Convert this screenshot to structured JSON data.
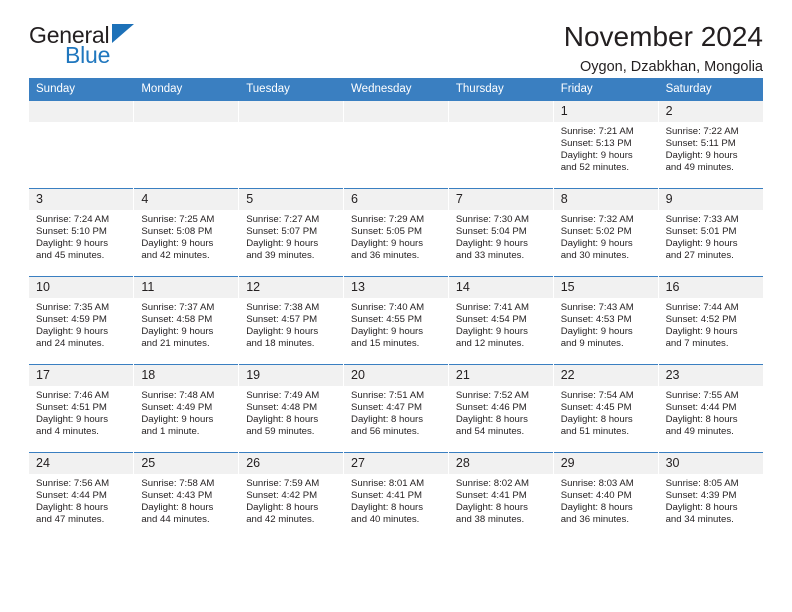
{
  "logo": {
    "line1": "General",
    "line2": "Blue",
    "triangle_icon": "triangle-icon",
    "color_dark": "#231f20",
    "color_blue": "#1d71b8"
  },
  "header": {
    "title": "November 2024",
    "subtitle": "Oygon, Dzabkhan, Mongolia"
  },
  "theme": {
    "header_blue": "#3a7fc1",
    "daynum_bg": "#f1f1f1",
    "text": "#231f20"
  },
  "weekday_headers": [
    "Sunday",
    "Monday",
    "Tuesday",
    "Wednesday",
    "Thursday",
    "Friday",
    "Saturday"
  ],
  "weeks": [
    [
      {
        "day": "",
        "sunrise": "",
        "sunset": "",
        "daylight1": "",
        "daylight2": ""
      },
      {
        "day": "",
        "sunrise": "",
        "sunset": "",
        "daylight1": "",
        "daylight2": ""
      },
      {
        "day": "",
        "sunrise": "",
        "sunset": "",
        "daylight1": "",
        "daylight2": ""
      },
      {
        "day": "",
        "sunrise": "",
        "sunset": "",
        "daylight1": "",
        "daylight2": ""
      },
      {
        "day": "",
        "sunrise": "",
        "sunset": "",
        "daylight1": "",
        "daylight2": ""
      },
      {
        "day": "1",
        "sunrise": "Sunrise: 7:21 AM",
        "sunset": "Sunset: 5:13 PM",
        "daylight1": "Daylight: 9 hours",
        "daylight2": "and 52 minutes."
      },
      {
        "day": "2",
        "sunrise": "Sunrise: 7:22 AM",
        "sunset": "Sunset: 5:11 PM",
        "daylight1": "Daylight: 9 hours",
        "daylight2": "and 49 minutes."
      }
    ],
    [
      {
        "day": "3",
        "sunrise": "Sunrise: 7:24 AM",
        "sunset": "Sunset: 5:10 PM",
        "daylight1": "Daylight: 9 hours",
        "daylight2": "and 45 minutes."
      },
      {
        "day": "4",
        "sunrise": "Sunrise: 7:25 AM",
        "sunset": "Sunset: 5:08 PM",
        "daylight1": "Daylight: 9 hours",
        "daylight2": "and 42 minutes."
      },
      {
        "day": "5",
        "sunrise": "Sunrise: 7:27 AM",
        "sunset": "Sunset: 5:07 PM",
        "daylight1": "Daylight: 9 hours",
        "daylight2": "and 39 minutes."
      },
      {
        "day": "6",
        "sunrise": "Sunrise: 7:29 AM",
        "sunset": "Sunset: 5:05 PM",
        "daylight1": "Daylight: 9 hours",
        "daylight2": "and 36 minutes."
      },
      {
        "day": "7",
        "sunrise": "Sunrise: 7:30 AM",
        "sunset": "Sunset: 5:04 PM",
        "daylight1": "Daylight: 9 hours",
        "daylight2": "and 33 minutes."
      },
      {
        "day": "8",
        "sunrise": "Sunrise: 7:32 AM",
        "sunset": "Sunset: 5:02 PM",
        "daylight1": "Daylight: 9 hours",
        "daylight2": "and 30 minutes."
      },
      {
        "day": "9",
        "sunrise": "Sunrise: 7:33 AM",
        "sunset": "Sunset: 5:01 PM",
        "daylight1": "Daylight: 9 hours",
        "daylight2": "and 27 minutes."
      }
    ],
    [
      {
        "day": "10",
        "sunrise": "Sunrise: 7:35 AM",
        "sunset": "Sunset: 4:59 PM",
        "daylight1": "Daylight: 9 hours",
        "daylight2": "and 24 minutes."
      },
      {
        "day": "11",
        "sunrise": "Sunrise: 7:37 AM",
        "sunset": "Sunset: 4:58 PM",
        "daylight1": "Daylight: 9 hours",
        "daylight2": "and 21 minutes."
      },
      {
        "day": "12",
        "sunrise": "Sunrise: 7:38 AM",
        "sunset": "Sunset: 4:57 PM",
        "daylight1": "Daylight: 9 hours",
        "daylight2": "and 18 minutes."
      },
      {
        "day": "13",
        "sunrise": "Sunrise: 7:40 AM",
        "sunset": "Sunset: 4:55 PM",
        "daylight1": "Daylight: 9 hours",
        "daylight2": "and 15 minutes."
      },
      {
        "day": "14",
        "sunrise": "Sunrise: 7:41 AM",
        "sunset": "Sunset: 4:54 PM",
        "daylight1": "Daylight: 9 hours",
        "daylight2": "and 12 minutes."
      },
      {
        "day": "15",
        "sunrise": "Sunrise: 7:43 AM",
        "sunset": "Sunset: 4:53 PM",
        "daylight1": "Daylight: 9 hours",
        "daylight2": "and 9 minutes."
      },
      {
        "day": "16",
        "sunrise": "Sunrise: 7:44 AM",
        "sunset": "Sunset: 4:52 PM",
        "daylight1": "Daylight: 9 hours",
        "daylight2": "and 7 minutes."
      }
    ],
    [
      {
        "day": "17",
        "sunrise": "Sunrise: 7:46 AM",
        "sunset": "Sunset: 4:51 PM",
        "daylight1": "Daylight: 9 hours",
        "daylight2": "and 4 minutes."
      },
      {
        "day": "18",
        "sunrise": "Sunrise: 7:48 AM",
        "sunset": "Sunset: 4:49 PM",
        "daylight1": "Daylight: 9 hours",
        "daylight2": "and 1 minute."
      },
      {
        "day": "19",
        "sunrise": "Sunrise: 7:49 AM",
        "sunset": "Sunset: 4:48 PM",
        "daylight1": "Daylight: 8 hours",
        "daylight2": "and 59 minutes."
      },
      {
        "day": "20",
        "sunrise": "Sunrise: 7:51 AM",
        "sunset": "Sunset: 4:47 PM",
        "daylight1": "Daylight: 8 hours",
        "daylight2": "and 56 minutes."
      },
      {
        "day": "21",
        "sunrise": "Sunrise: 7:52 AM",
        "sunset": "Sunset: 4:46 PM",
        "daylight1": "Daylight: 8 hours",
        "daylight2": "and 54 minutes."
      },
      {
        "day": "22",
        "sunrise": "Sunrise: 7:54 AM",
        "sunset": "Sunset: 4:45 PM",
        "daylight1": "Daylight: 8 hours",
        "daylight2": "and 51 minutes."
      },
      {
        "day": "23",
        "sunrise": "Sunrise: 7:55 AM",
        "sunset": "Sunset: 4:44 PM",
        "daylight1": "Daylight: 8 hours",
        "daylight2": "and 49 minutes."
      }
    ],
    [
      {
        "day": "24",
        "sunrise": "Sunrise: 7:56 AM",
        "sunset": "Sunset: 4:44 PM",
        "daylight1": "Daylight: 8 hours",
        "daylight2": "and 47 minutes."
      },
      {
        "day": "25",
        "sunrise": "Sunrise: 7:58 AM",
        "sunset": "Sunset: 4:43 PM",
        "daylight1": "Daylight: 8 hours",
        "daylight2": "and 44 minutes."
      },
      {
        "day": "26",
        "sunrise": "Sunrise: 7:59 AM",
        "sunset": "Sunset: 4:42 PM",
        "daylight1": "Daylight: 8 hours",
        "daylight2": "and 42 minutes."
      },
      {
        "day": "27",
        "sunrise": "Sunrise: 8:01 AM",
        "sunset": "Sunset: 4:41 PM",
        "daylight1": "Daylight: 8 hours",
        "daylight2": "and 40 minutes."
      },
      {
        "day": "28",
        "sunrise": "Sunrise: 8:02 AM",
        "sunset": "Sunset: 4:41 PM",
        "daylight1": "Daylight: 8 hours",
        "daylight2": "and 38 minutes."
      },
      {
        "day": "29",
        "sunrise": "Sunrise: 8:03 AM",
        "sunset": "Sunset: 4:40 PM",
        "daylight1": "Daylight: 8 hours",
        "daylight2": "and 36 minutes."
      },
      {
        "day": "30",
        "sunrise": "Sunrise: 8:05 AM",
        "sunset": "Sunset: 4:39 PM",
        "daylight1": "Daylight: 8 hours",
        "daylight2": "and 34 minutes."
      }
    ]
  ]
}
